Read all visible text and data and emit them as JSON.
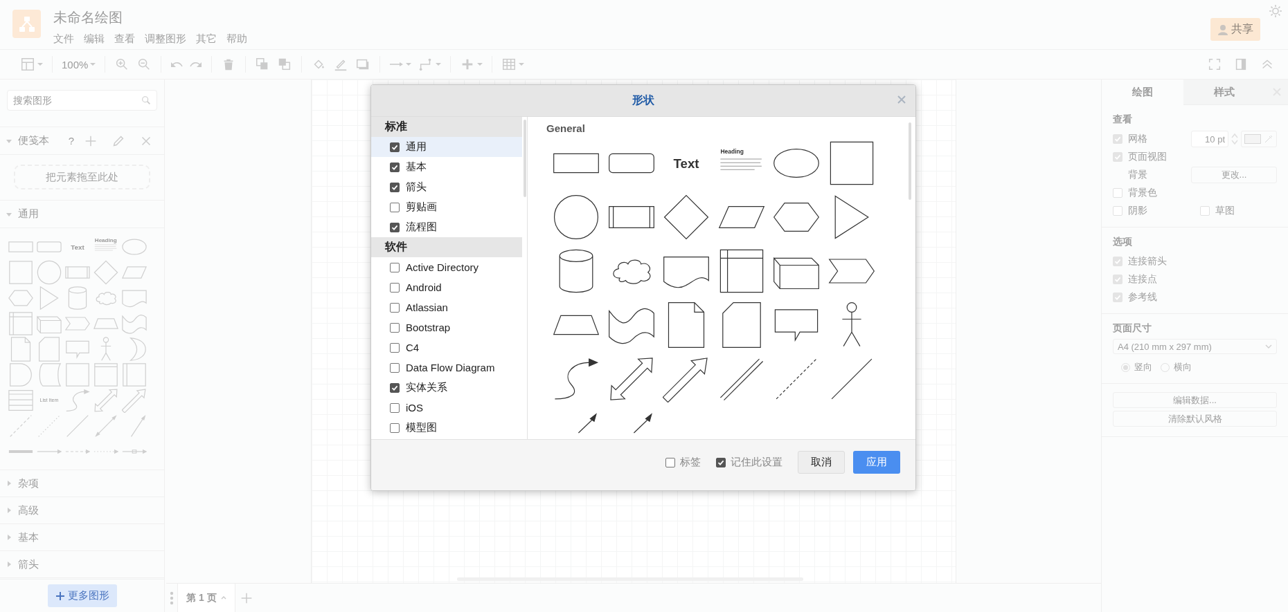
{
  "header": {
    "title": "未命名绘图",
    "menus": [
      "文件",
      "编辑",
      "查看",
      "调整图形",
      "其它",
      "帮助"
    ],
    "share_button": "共享"
  },
  "toolbar": {
    "zoom": "100%"
  },
  "sidebar": {
    "search": {
      "placeholder": "搜索图形"
    },
    "scratchpad": {
      "title": "便笺本",
      "expanded": true,
      "help": "?",
      "drop_hint": "把元素拖至此处"
    },
    "general": {
      "title": "通用",
      "expanded": true,
      "shapes": [
        {
          "kind": "rectangle"
        },
        {
          "kind": "rounded-rectangle"
        },
        {
          "kind": "text",
          "label": "Text"
        },
        {
          "kind": "textbox",
          "label": "Heading"
        },
        {
          "kind": "ellipse"
        },
        {
          "kind": "square"
        },
        {
          "kind": "circle"
        },
        {
          "kind": "process"
        },
        {
          "kind": "diamond"
        },
        {
          "kind": "parallelogram"
        },
        {
          "kind": "hexagon"
        },
        {
          "kind": "triangle"
        },
        {
          "kind": "cylinder"
        },
        {
          "kind": "cloud"
        },
        {
          "kind": "document"
        },
        {
          "kind": "internal-storage"
        },
        {
          "kind": "cube"
        },
        {
          "kind": "step"
        },
        {
          "kind": "trapezoid"
        },
        {
          "kind": "tape"
        },
        {
          "kind": "note"
        },
        {
          "kind": "card"
        },
        {
          "kind": "callout"
        },
        {
          "kind": "actor"
        },
        {
          "kind": "crescent"
        },
        {
          "kind": "delay"
        },
        {
          "kind": "data-storage"
        },
        {
          "kind": "container"
        },
        {
          "kind": "window"
        },
        {
          "kind": "list-container"
        },
        {
          "kind": "list"
        },
        {
          "kind": "caption",
          "label": "List Item"
        },
        {
          "kind": "curve"
        },
        {
          "kind": "bidirectional-arrow"
        },
        {
          "kind": "arrow"
        },
        {
          "kind": "dashed-line"
        },
        {
          "kind": "dotted-line"
        },
        {
          "kind": "line"
        },
        {
          "kind": "bidirectional-line"
        },
        {
          "kind": "line-arrow"
        },
        {
          "kind": "thick-line"
        },
        {
          "kind": "connector"
        },
        {
          "kind": "dashed-connector"
        },
        {
          "kind": "dotted-connector"
        },
        {
          "kind": "labeled-connector"
        }
      ]
    },
    "sections": [
      {
        "title": "杂项",
        "expanded": false
      },
      {
        "title": "高级",
        "expanded": false
      },
      {
        "title": "基本",
        "expanded": false
      },
      {
        "title": "箭头",
        "expanded": false
      }
    ],
    "more_button": "更多图形"
  },
  "page_tabs": [
    {
      "label": "第 1 页",
      "selected": true
    }
  ],
  "format_panel": {
    "tabs": [
      {
        "label": "绘图",
        "selected": true
      },
      {
        "label": "样式",
        "selected": false
      }
    ],
    "view": {
      "title": "查看",
      "grid": {
        "label": "网格",
        "checked": true,
        "size": "10 pt"
      },
      "page_view": {
        "label": "页面视图",
        "checked": true
      },
      "background": {
        "label": "背景",
        "button": "更改..."
      },
      "background_color": {
        "label": "背景色",
        "checked": false
      },
      "shadow": {
        "label": "阴影",
        "checked": false
      },
      "sketch": {
        "label": "草图",
        "checked": false
      }
    },
    "options": {
      "title": "选项",
      "items": [
        {
          "label": "连接箭头",
          "checked": true
        },
        {
          "label": "连接点",
          "checked": true
        },
        {
          "label": "参考线",
          "checked": true
        }
      ]
    },
    "page_size": {
      "title": "页面尺寸",
      "value": "A4 (210 mm x 297 mm)",
      "orientations": [
        {
          "label": "竖向",
          "selected": true
        },
        {
          "label": "横向",
          "selected": false
        }
      ]
    },
    "buttons": [
      "编辑数据...",
      "清除默认风格"
    ]
  },
  "dialog": {
    "title": "形状",
    "groups": [
      {
        "title": "标准",
        "items": [
          {
            "label": "通用",
            "checked": true,
            "selected": true
          },
          {
            "label": "基本",
            "checked": true,
            "selected": false
          },
          {
            "label": "箭头",
            "checked": true,
            "selected": false
          },
          {
            "label": "剪贴画",
            "checked": false,
            "selected": false
          },
          {
            "label": "流程图",
            "checked": true,
            "selected": false
          }
        ]
      },
      {
        "title": "软件",
        "items": [
          {
            "label": "Active Directory",
            "checked": false,
            "selected": false
          },
          {
            "label": "Android",
            "checked": false,
            "selected": false
          },
          {
            "label": "Atlassian",
            "checked": false,
            "selected": false
          },
          {
            "label": "Bootstrap",
            "checked": false,
            "selected": false
          },
          {
            "label": "C4",
            "checked": false,
            "selected": false
          },
          {
            "label": "Data Flow Diagram",
            "checked": false,
            "selected": false
          },
          {
            "label": "实体关系",
            "checked": true,
            "selected": false
          },
          {
            "label": "iOS",
            "checked": false,
            "selected": false
          },
          {
            "label": "模型图",
            "checked": false,
            "selected": false
          }
        ]
      }
    ],
    "preview_title": "General",
    "shapes": [
      {
        "kind": "rectangle"
      },
      {
        "kind": "rounded-rectangle"
      },
      {
        "kind": "text",
        "label": "Text"
      },
      {
        "kind": "textbox",
        "label": "Heading"
      },
      {
        "kind": "ellipse"
      },
      {
        "kind": "square"
      },
      {
        "kind": "circle"
      },
      {
        "kind": "process"
      },
      {
        "kind": "diamond"
      },
      {
        "kind": "parallelogram"
      },
      {
        "kind": "hexagon"
      },
      {
        "kind": "triangle"
      },
      {
        "kind": "cylinder"
      },
      {
        "kind": "cloud"
      },
      {
        "kind": "document"
      },
      {
        "kind": "internal-storage"
      },
      {
        "kind": "cube"
      },
      {
        "kind": "step"
      },
      {
        "kind": "trapezoid"
      },
      {
        "kind": "tape"
      },
      {
        "kind": "note"
      },
      {
        "kind": "card"
      },
      {
        "kind": "callout"
      },
      {
        "kind": "actor"
      },
      {
        "kind": "curve"
      },
      {
        "kind": "bidirectional-arrow"
      },
      {
        "kind": "arrow"
      },
      {
        "kind": "link"
      },
      {
        "kind": "dashed-line"
      },
      {
        "kind": "line"
      },
      {
        "kind": "short-arrow"
      },
      {
        "kind": "short-arrow"
      }
    ],
    "footer": {
      "labels": {
        "label": "标签",
        "checked": false
      },
      "remember": {
        "label": "记住此设置",
        "checked": true
      },
      "cancel_button": "取消",
      "apply_button": "应用"
    }
  }
}
